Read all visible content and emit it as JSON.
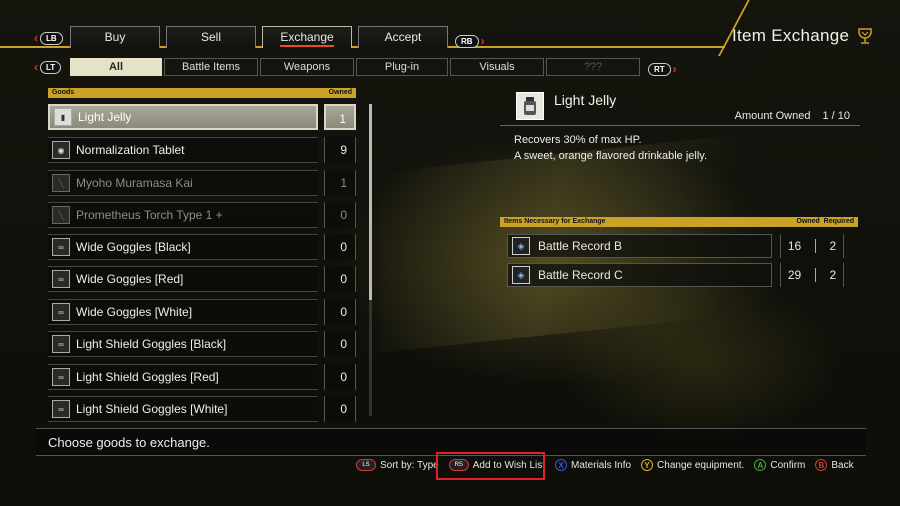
{
  "header": {
    "title": "Item Exchange",
    "lb": "LB",
    "rb": "RB",
    "lt": "LT",
    "rt": "RT",
    "main_tabs": [
      {
        "label": "Buy"
      },
      {
        "label": "Sell"
      },
      {
        "label": "Exchange"
      },
      {
        "label": "Accept"
      }
    ],
    "sub_tabs": [
      {
        "label": "All"
      },
      {
        "label": "Battle Items"
      },
      {
        "label": "Weapons"
      },
      {
        "label": "Plug-in"
      },
      {
        "label": "Visuals"
      },
      {
        "label": "???"
      }
    ]
  },
  "list": {
    "goods_header": "Goods",
    "owned_header": "Owned",
    "items": [
      {
        "name": "Light Jelly",
        "owned": "1",
        "icon": "jelly-jar-icon"
      },
      {
        "name": "Normalization Tablet",
        "owned": "9",
        "icon": "tablet-icon"
      },
      {
        "name": "Myoho Muramasa Kai",
        "owned": "1",
        "icon": "sword-icon"
      },
      {
        "name": "Prometheus Torch Type 1 +",
        "owned": "0",
        "icon": "sword-icon"
      },
      {
        "name": "Wide Goggles [Black]",
        "owned": "0",
        "icon": "goggles-icon"
      },
      {
        "name": "Wide Goggles [Red]",
        "owned": "0",
        "icon": "goggles-icon"
      },
      {
        "name": "Wide Goggles [White]",
        "owned": "0",
        "icon": "goggles-icon"
      },
      {
        "name": "Light Shield Goggles [Black]",
        "owned": "0",
        "icon": "goggles-icon"
      },
      {
        "name": "Light Shield Goggles [Red]",
        "owned": "0",
        "icon": "goggles-icon"
      },
      {
        "name": "Light Shield Goggles [White]",
        "owned": "0",
        "icon": "goggles-icon"
      }
    ]
  },
  "detail": {
    "name": "Light Jelly",
    "amount_label": "Amount Owned",
    "amount_value": "1 / 10",
    "desc_line1": "Recovers 30% of max HP.",
    "desc_line2": "A sweet, orange flavored drinkable jelly.",
    "req_header": "Items Necessary for Exchange",
    "req_owned_label": "Owned",
    "req_required_label": "Required",
    "requirements": [
      {
        "name": "Battle Record B",
        "owned": "16",
        "required": "2"
      },
      {
        "name": "Battle Record C",
        "owned": "29",
        "required": "2"
      }
    ]
  },
  "footer": {
    "message": "Choose goods to exchange.",
    "hints": [
      {
        "button": "LS",
        "label": "Sort by: Type"
      },
      {
        "button": "RS",
        "label": "Add to Wish List"
      },
      {
        "button": "X",
        "label": "Materials Info"
      },
      {
        "button": "Y",
        "label": "Change equipment."
      },
      {
        "button": "A",
        "label": "Confirm"
      },
      {
        "button": "B",
        "label": "Back"
      }
    ]
  },
  "colors": {
    "accent_gold": "#c9a227",
    "selection_red": "#e0202a",
    "button_x": "#3a5bd9",
    "button_y": "#d9b22a",
    "button_a": "#3fae3a",
    "button_b": "#d23a2a"
  }
}
